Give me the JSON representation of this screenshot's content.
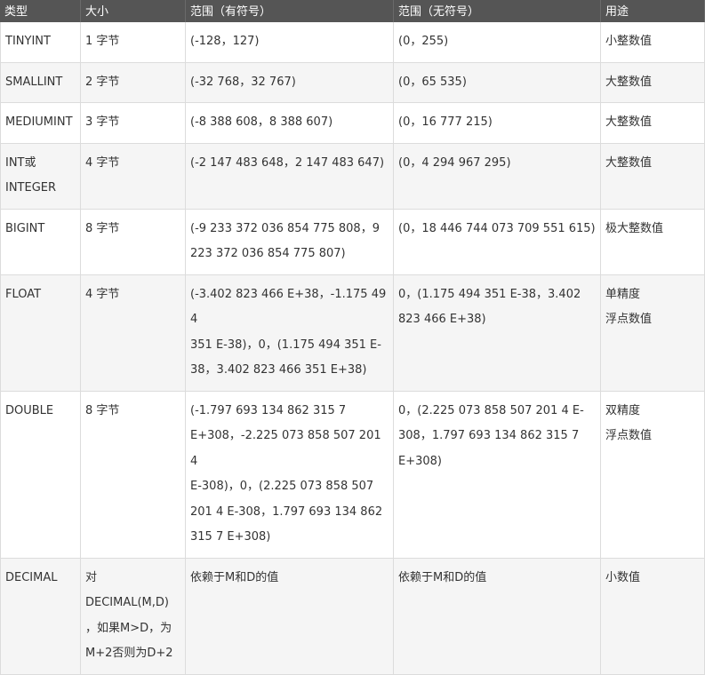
{
  "table": {
    "headers": [
      "类型",
      "大小",
      "范围（有符号）",
      "范围（无符号）",
      "用途"
    ],
    "rows": [
      {
        "type": [
          "TINYINT"
        ],
        "size": [
          "1 字节"
        ],
        "signed": [
          "(-128，127)"
        ],
        "unsigned": [
          "(0，255)"
        ],
        "use": [
          "小整数值"
        ]
      },
      {
        "type": [
          "SMALLINT"
        ],
        "size": [
          "2 字节"
        ],
        "signed": [
          "(-32 768，32 767)"
        ],
        "unsigned": [
          "(0，65 535)"
        ],
        "use": [
          "大整数值"
        ]
      },
      {
        "type": [
          "MEDIUMINT"
        ],
        "size": [
          "3 字节"
        ],
        "signed": [
          "(-8 388 608，8 388 607)"
        ],
        "unsigned": [
          "(0，16 777 215)"
        ],
        "use": [
          "大整数值"
        ]
      },
      {
        "type": [
          "INT或",
          "INTEGER"
        ],
        "size": [
          "4 字节"
        ],
        "signed": [
          "(-2 147 483 648，2 147 483 647)"
        ],
        "unsigned": [
          "(0，4 294 967 295)"
        ],
        "use": [
          "大整数值"
        ]
      },
      {
        "type": [
          "BIGINT"
        ],
        "size": [
          "8 字节"
        ],
        "signed": [
          "(-9 233 372 036 854 775 808，9",
          "223 372 036 854 775 807)"
        ],
        "unsigned": [
          "(0，18 446 744 073 709 551 615)"
        ],
        "use": [
          "极大整数值"
        ]
      },
      {
        "type": [
          "FLOAT"
        ],
        "size": [
          "4 字节"
        ],
        "signed": [
          "(-3.402 823 466 E+38，-1.175 494",
          "351 E-38)，0，(1.175 494 351 E-",
          "38，3.402 823 466 351 E+38)"
        ],
        "unsigned": [
          "0，(1.175 494 351 E-38，3.402",
          "823 466 E+38)"
        ],
        "use": [
          "单精度",
          "浮点数值"
        ]
      },
      {
        "type": [
          "DOUBLE"
        ],
        "size": [
          "8 字节"
        ],
        "signed": [
          "(-1.797 693 134 862 315 7",
          "E+308，-2.225 073 858 507 201 4",
          "E-308)，0，(2.225 073 858 507",
          "201 4 E-308，1.797 693 134 862",
          "315 7 E+308)"
        ],
        "unsigned": [
          "0，(2.225 073 858 507 201 4 E-",
          "308，1.797 693 134 862 315 7",
          "E+308)"
        ],
        "use": [
          "双精度",
          "浮点数值"
        ]
      },
      {
        "type": [
          "DECIMAL"
        ],
        "size": [
          "对",
          "DECIMAL(M,D)",
          "，如果M>D，为",
          "M+2否则为D+2"
        ],
        "signed": [
          "依赖于M和D的值"
        ],
        "unsigned": [
          "依赖于M和D的值"
        ],
        "use": [
          "小数值"
        ]
      }
    ]
  }
}
